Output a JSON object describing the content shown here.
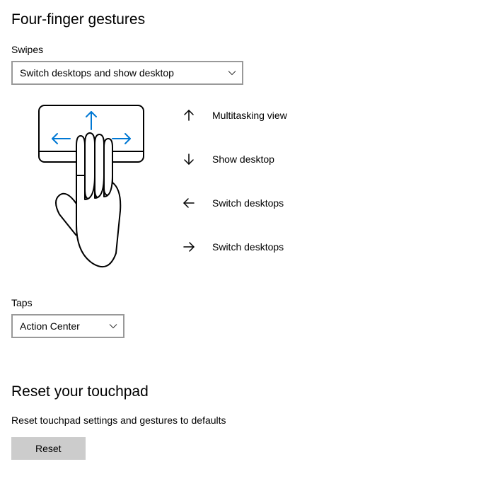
{
  "headings": {
    "gestures": "Four-finger gestures",
    "reset": "Reset your touchpad"
  },
  "swipes": {
    "label": "Swipes",
    "selected": "Switch desktops and show desktop"
  },
  "actions": {
    "up": "Multitasking view",
    "down": "Show desktop",
    "left": "Switch desktops",
    "right": "Switch desktops"
  },
  "taps": {
    "label": "Taps",
    "selected": "Action Center"
  },
  "reset": {
    "desc": "Reset touchpad settings and gestures to defaults",
    "button": "Reset"
  }
}
